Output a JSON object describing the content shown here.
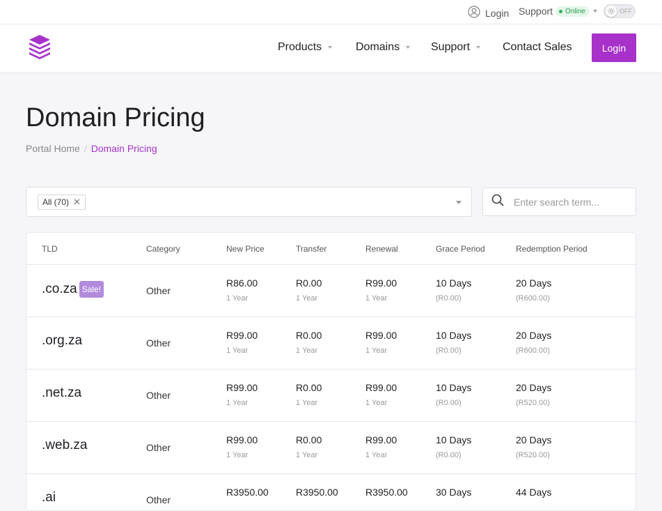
{
  "topbar": {
    "login_label": "Login",
    "support_label": "Support",
    "support_status": "Online",
    "toggle_label": "OFF"
  },
  "nav": {
    "products": "Products",
    "domains": "Domains",
    "support": "Support",
    "contact": "Contact Sales",
    "login_button": "Login"
  },
  "page": {
    "title": "Domain Pricing",
    "breadcrumb": [
      "Portal Home",
      "Domain Pricing"
    ]
  },
  "filters": {
    "chip_label": "All (70)",
    "search_placeholder": "Enter search term..."
  },
  "table": {
    "headers": [
      "TLD",
      "Category",
      "New Price",
      "Transfer",
      "Renewal",
      "Grace Period",
      "Redemption Period"
    ],
    "rows": [
      {
        "tld": ".co.za",
        "sale": "Sale!",
        "category": "Other",
        "new_price": "R86.00",
        "new_term": "1 Year",
        "transfer": "R0.00",
        "transfer_term": "1 Year",
        "renewal": "R99.00",
        "renewal_term": "1 Year",
        "grace": "10 Days",
        "grace_fee": "(R0.00)",
        "redemption": "20 Days",
        "redemption_fee": "(R600.00)"
      },
      {
        "tld": ".org.za",
        "sale": "",
        "category": "Other",
        "new_price": "R99.00",
        "new_term": "1 Year",
        "transfer": "R0.00",
        "transfer_term": "1 Year",
        "renewal": "R99.00",
        "renewal_term": "1 Year",
        "grace": "10 Days",
        "grace_fee": "(R0.00)",
        "redemption": "20 Days",
        "redemption_fee": "(R600.00)"
      },
      {
        "tld": ".net.za",
        "sale": "",
        "category": "Other",
        "new_price": "R99.00",
        "new_term": "1 Year",
        "transfer": "R0.00",
        "transfer_term": "1 Year",
        "renewal": "R99.00",
        "renewal_term": "1 Year",
        "grace": "10 Days",
        "grace_fee": "(R0.00)",
        "redemption": "20 Days",
        "redemption_fee": "(R520.00)"
      },
      {
        "tld": ".web.za",
        "sale": "",
        "category": "Other",
        "new_price": "R99.00",
        "new_term": "1 Year",
        "transfer": "R0.00",
        "transfer_term": "1 Year",
        "renewal": "R99.00",
        "renewal_term": "1 Year",
        "grace": "10 Days",
        "grace_fee": "(R0.00)",
        "redemption": "20 Days",
        "redemption_fee": "(R520.00)"
      },
      {
        "tld": ".ai",
        "sale": "",
        "category": "Other",
        "new_price": "R3950.00",
        "new_term": "",
        "transfer": "R3950.00",
        "transfer_term": "",
        "renewal": "R3950.00",
        "renewal_term": "",
        "grace": "30 Days",
        "grace_fee": "",
        "redemption": "44 Days",
        "redemption_fee": ""
      }
    ]
  },
  "colors": {
    "accent": "#a832c9",
    "sale_badge": "#b38bdc",
    "online": "#2fb559"
  }
}
